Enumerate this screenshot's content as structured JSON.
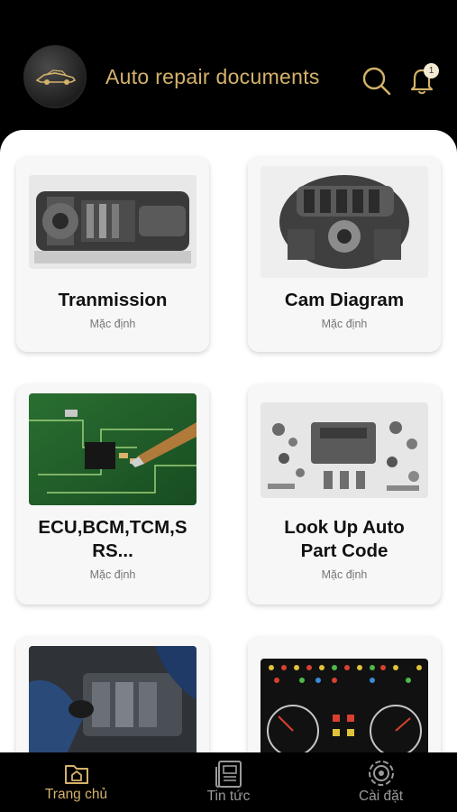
{
  "header": {
    "title": "Auto repair documents",
    "notification_count": "1",
    "icons": {
      "logo": "car-logo-icon",
      "search": "search-icon",
      "bell": "bell-icon"
    },
    "accent_color": "#d4b26a"
  },
  "cards": [
    {
      "title": "Tranmission",
      "subtitle": "Mặc định",
      "image": "transmission-image"
    },
    {
      "title": "Cam Diagram",
      "subtitle": "Mặc định",
      "image": "engine-image"
    },
    {
      "title": "ECU,BCM,TCM,S RS...",
      "subtitle": "Mặc định",
      "image": "circuit-board-image"
    },
    {
      "title": "Look Up Auto Part Code",
      "subtitle": "Mặc định",
      "image": "engine-parts-image"
    },
    {
      "title": "",
      "subtitle": "",
      "image": "mechanic-engine-image"
    },
    {
      "title": "",
      "subtitle": "",
      "image": "dashboard-warning-lights-image"
    }
  ],
  "nav": {
    "items": [
      {
        "label": "Trang chủ",
        "icon": "home-folder-icon",
        "active": true
      },
      {
        "label": "Tin tức",
        "icon": "news-icon",
        "active": false
      },
      {
        "label": "Cài đặt",
        "icon": "settings-gear-icon",
        "active": false
      }
    ],
    "active_color": "#d4b26a",
    "inactive_color": "#9a9a9a"
  }
}
